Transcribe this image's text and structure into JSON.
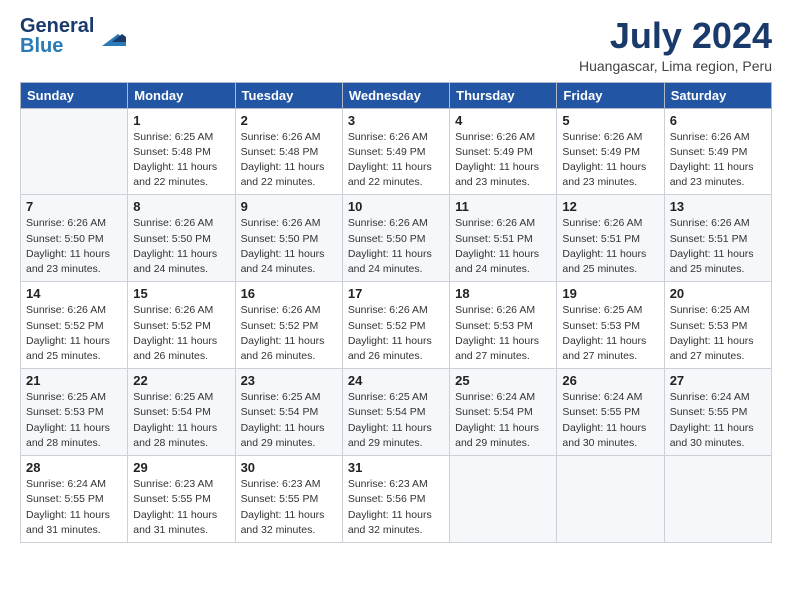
{
  "header": {
    "logo_line1": "General",
    "logo_line2": "Blue",
    "title": "July 2024",
    "subtitle": "Huangascar, Lima region, Peru"
  },
  "calendar": {
    "weekdays": [
      "Sunday",
      "Monday",
      "Tuesday",
      "Wednesday",
      "Thursday",
      "Friday",
      "Saturday"
    ],
    "weeks": [
      [
        {
          "day": "",
          "info": ""
        },
        {
          "day": "1",
          "info": "Sunrise: 6:25 AM\nSunset: 5:48 PM\nDaylight: 11 hours\nand 22 minutes."
        },
        {
          "day": "2",
          "info": "Sunrise: 6:26 AM\nSunset: 5:48 PM\nDaylight: 11 hours\nand 22 minutes."
        },
        {
          "day": "3",
          "info": "Sunrise: 6:26 AM\nSunset: 5:49 PM\nDaylight: 11 hours\nand 22 minutes."
        },
        {
          "day": "4",
          "info": "Sunrise: 6:26 AM\nSunset: 5:49 PM\nDaylight: 11 hours\nand 23 minutes."
        },
        {
          "day": "5",
          "info": "Sunrise: 6:26 AM\nSunset: 5:49 PM\nDaylight: 11 hours\nand 23 minutes."
        },
        {
          "day": "6",
          "info": "Sunrise: 6:26 AM\nSunset: 5:49 PM\nDaylight: 11 hours\nand 23 minutes."
        }
      ],
      [
        {
          "day": "7",
          "info": "Sunrise: 6:26 AM\nSunset: 5:50 PM\nDaylight: 11 hours\nand 23 minutes."
        },
        {
          "day": "8",
          "info": "Sunrise: 6:26 AM\nSunset: 5:50 PM\nDaylight: 11 hours\nand 24 minutes."
        },
        {
          "day": "9",
          "info": "Sunrise: 6:26 AM\nSunset: 5:50 PM\nDaylight: 11 hours\nand 24 minutes."
        },
        {
          "day": "10",
          "info": "Sunrise: 6:26 AM\nSunset: 5:50 PM\nDaylight: 11 hours\nand 24 minutes."
        },
        {
          "day": "11",
          "info": "Sunrise: 6:26 AM\nSunset: 5:51 PM\nDaylight: 11 hours\nand 24 minutes."
        },
        {
          "day": "12",
          "info": "Sunrise: 6:26 AM\nSunset: 5:51 PM\nDaylight: 11 hours\nand 25 minutes."
        },
        {
          "day": "13",
          "info": "Sunrise: 6:26 AM\nSunset: 5:51 PM\nDaylight: 11 hours\nand 25 minutes."
        }
      ],
      [
        {
          "day": "14",
          "info": "Sunrise: 6:26 AM\nSunset: 5:52 PM\nDaylight: 11 hours\nand 25 minutes."
        },
        {
          "day": "15",
          "info": "Sunrise: 6:26 AM\nSunset: 5:52 PM\nDaylight: 11 hours\nand 26 minutes."
        },
        {
          "day": "16",
          "info": "Sunrise: 6:26 AM\nSunset: 5:52 PM\nDaylight: 11 hours\nand 26 minutes."
        },
        {
          "day": "17",
          "info": "Sunrise: 6:26 AM\nSunset: 5:52 PM\nDaylight: 11 hours\nand 26 minutes."
        },
        {
          "day": "18",
          "info": "Sunrise: 6:26 AM\nSunset: 5:53 PM\nDaylight: 11 hours\nand 27 minutes."
        },
        {
          "day": "19",
          "info": "Sunrise: 6:25 AM\nSunset: 5:53 PM\nDaylight: 11 hours\nand 27 minutes."
        },
        {
          "day": "20",
          "info": "Sunrise: 6:25 AM\nSunset: 5:53 PM\nDaylight: 11 hours\nand 27 minutes."
        }
      ],
      [
        {
          "day": "21",
          "info": "Sunrise: 6:25 AM\nSunset: 5:53 PM\nDaylight: 11 hours\nand 28 minutes."
        },
        {
          "day": "22",
          "info": "Sunrise: 6:25 AM\nSunset: 5:54 PM\nDaylight: 11 hours\nand 28 minutes."
        },
        {
          "day": "23",
          "info": "Sunrise: 6:25 AM\nSunset: 5:54 PM\nDaylight: 11 hours\nand 29 minutes."
        },
        {
          "day": "24",
          "info": "Sunrise: 6:25 AM\nSunset: 5:54 PM\nDaylight: 11 hours\nand 29 minutes."
        },
        {
          "day": "25",
          "info": "Sunrise: 6:24 AM\nSunset: 5:54 PM\nDaylight: 11 hours\nand 29 minutes."
        },
        {
          "day": "26",
          "info": "Sunrise: 6:24 AM\nSunset: 5:55 PM\nDaylight: 11 hours\nand 30 minutes."
        },
        {
          "day": "27",
          "info": "Sunrise: 6:24 AM\nSunset: 5:55 PM\nDaylight: 11 hours\nand 30 minutes."
        }
      ],
      [
        {
          "day": "28",
          "info": "Sunrise: 6:24 AM\nSunset: 5:55 PM\nDaylight: 11 hours\nand 31 minutes."
        },
        {
          "day": "29",
          "info": "Sunrise: 6:23 AM\nSunset: 5:55 PM\nDaylight: 11 hours\nand 31 minutes."
        },
        {
          "day": "30",
          "info": "Sunrise: 6:23 AM\nSunset: 5:55 PM\nDaylight: 11 hours\nand 32 minutes."
        },
        {
          "day": "31",
          "info": "Sunrise: 6:23 AM\nSunset: 5:56 PM\nDaylight: 11 hours\nand 32 minutes."
        },
        {
          "day": "",
          "info": ""
        },
        {
          "day": "",
          "info": ""
        },
        {
          "day": "",
          "info": ""
        }
      ]
    ]
  }
}
